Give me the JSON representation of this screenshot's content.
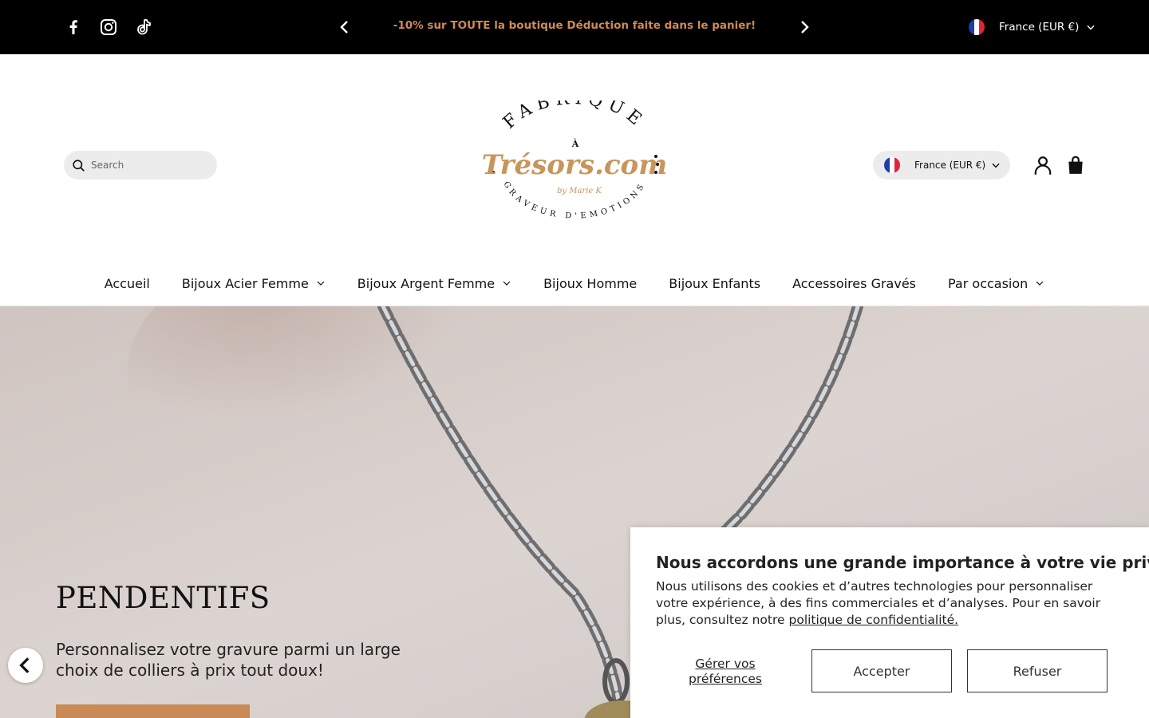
{
  "announcement": {
    "text": "-10% sur TOUTE la boutique Déduction faite dans le panier!",
    "country": "France (EUR €)",
    "social_icons": [
      "facebook-icon",
      "instagram-icon",
      "tiktok-icon"
    ]
  },
  "header": {
    "search_placeholder": "Search",
    "logo": {
      "top": "FABRIQUE",
      "middle": "À",
      "brand": "Trésors.com",
      "byline": "by Marie K",
      "bottom": "GRAVEUR D'EMOTIONS"
    },
    "country": "France (EUR €)"
  },
  "nav": {
    "items": [
      {
        "label": "Accueil",
        "dropdown": false
      },
      {
        "label": "Bijoux Acier Femme",
        "dropdown": true
      },
      {
        "label": "Bijoux Argent Femme",
        "dropdown": true
      },
      {
        "label": "Bijoux Homme",
        "dropdown": false
      },
      {
        "label": "Bijoux Enfants",
        "dropdown": false
      },
      {
        "label": "Accessoires Gravés",
        "dropdown": false
      },
      {
        "label": "Par occasion",
        "dropdown": true
      }
    ]
  },
  "hero": {
    "title": "PENDENTIFS",
    "subtitle": "Personnalisez votre gravure parmi un large choix de colliers à prix tout doux!"
  },
  "cookie": {
    "title": "Nous accordons une grande importance à votre vie privée",
    "body": "Nous utilisons des cookies et d’autres technologies pour personnaliser votre expérience, à des fins commerciales et d’analyses. Pour en savoir plus, consultez notre ",
    "link": "politique de confidentialité.",
    "manage": "Gérer vos préférences",
    "accept": "Accepter",
    "decline": "Refuser"
  },
  "colors": {
    "accent": "#d08a55",
    "button": "#c98a57",
    "brand_gold": "#c8955a",
    "flag_blue": "#1c3faa",
    "flag_red": "#e3233a"
  }
}
